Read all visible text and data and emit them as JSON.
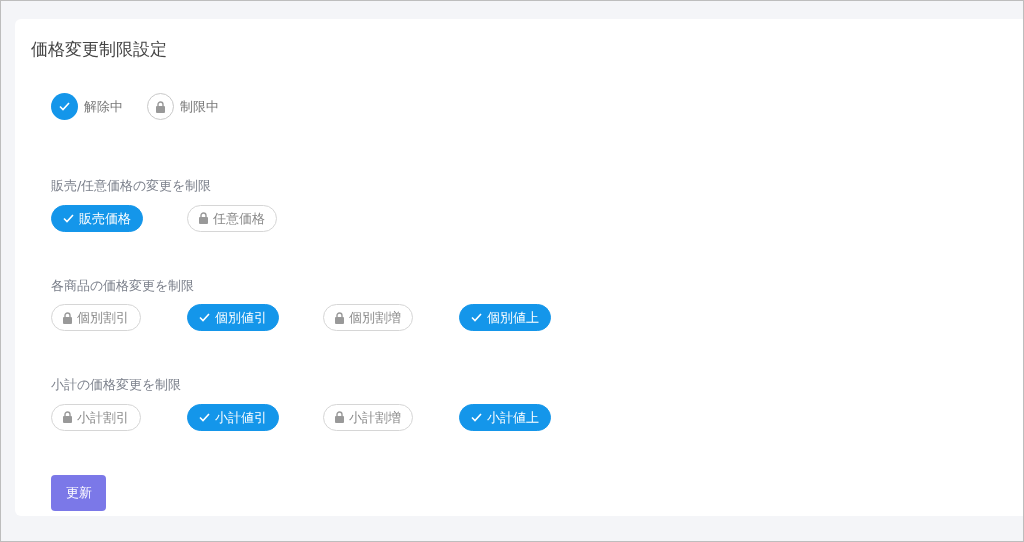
{
  "title": "価格変更制限設定",
  "legend": [
    {
      "label": "解除中",
      "kind": "released"
    },
    {
      "label": "制限中",
      "kind": "restricted"
    }
  ],
  "sections": [
    {
      "label": "販売/任意価格の変更を制限",
      "options": [
        {
          "label": "販売価格",
          "released": true
        },
        {
          "label": "任意価格",
          "released": false
        }
      ]
    },
    {
      "label": "各商品の価格変更を制限",
      "options": [
        {
          "label": "個別割引",
          "released": false
        },
        {
          "label": "個別値引",
          "released": true
        },
        {
          "label": "個別割増",
          "released": false
        },
        {
          "label": "個別値上",
          "released": true
        }
      ]
    },
    {
      "label": "小計の価格変更を制限",
      "options": [
        {
          "label": "小計割引",
          "released": false
        },
        {
          "label": "小計値引",
          "released": true
        },
        {
          "label": "小計割増",
          "released": false
        },
        {
          "label": "小計値上",
          "released": true
        }
      ]
    }
  ],
  "submit": "更新"
}
